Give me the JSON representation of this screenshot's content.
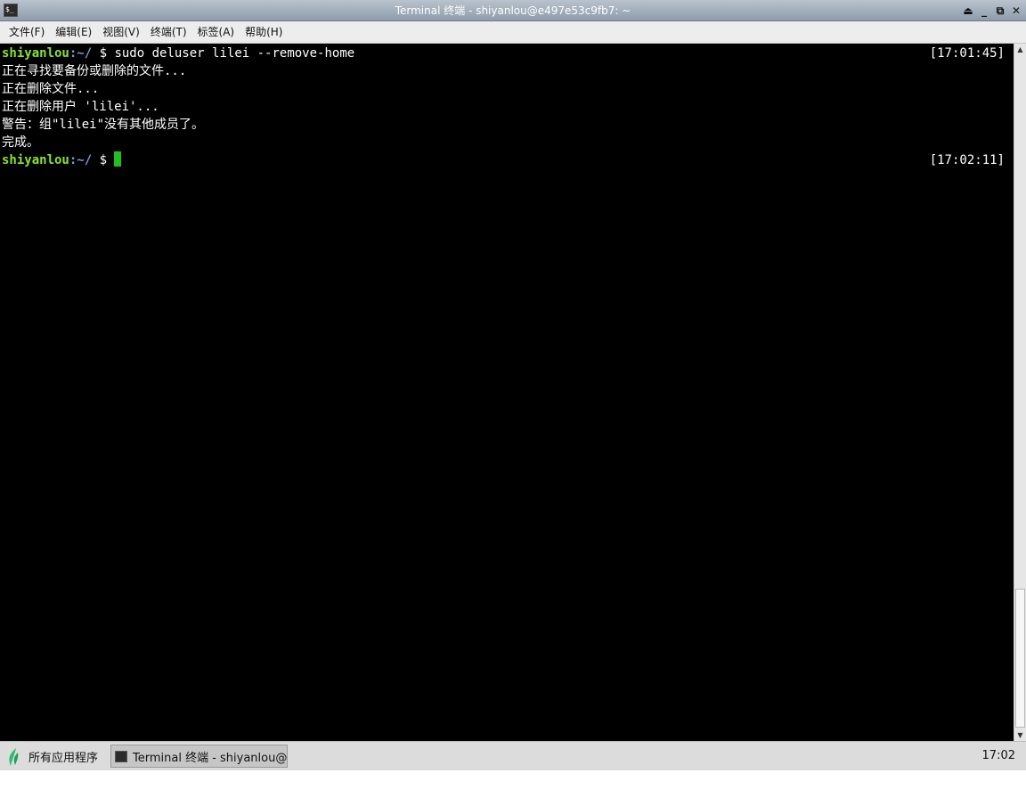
{
  "window": {
    "title": "Terminal 终端 - shiyanlou@e497e53c9fb7: ~",
    "controls": [
      "⏏",
      "_",
      "⧉",
      "✕"
    ]
  },
  "menu": [
    {
      "label": "文件(F)"
    },
    {
      "label": "编辑(E)"
    },
    {
      "label": "视图(V)"
    },
    {
      "label": "终端(T)"
    },
    {
      "label": "标签(A)"
    },
    {
      "label": "帮助(H)"
    }
  ],
  "terminal": {
    "prompt_user": "shiyanlou",
    "prompt_path": ":~/",
    "prompt_symbol": " $ ",
    "command": "sudo deluser lilei --remove-home",
    "timestamp_1": "[17:01:45]",
    "output": [
      "正在寻找要备份或删除的文件...",
      "正在删除文件...",
      "正在删除用户 'lilei'...",
      "警告：组\"lilei\"没有其他成员了。",
      "完成。"
    ],
    "timestamp_2": "[17:02:11]",
    "colors": {
      "user": "#8ae234",
      "path": "#729fcf",
      "cursor": "#1fbf1f"
    }
  },
  "taskbar": {
    "start_label": "所有应用程序",
    "task_label": "Terminal 终端 - shiyanlou@···",
    "clock": "17:02"
  }
}
